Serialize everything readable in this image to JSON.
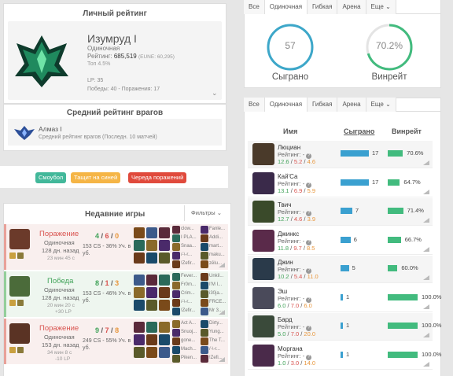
{
  "personal_rating": {
    "title": "Личный рейтинг",
    "tier": "Изумруд I",
    "queue": "Одиночная",
    "rating_label": "Рейтинг:",
    "rating_value": "685,519",
    "rating_region": "(EUNE: 60,295)",
    "top": "Топ 4.5%",
    "lp": "LP: 35",
    "wins_losses": "Победы: 40 - Поражения: 17"
  },
  "enemy_rating": {
    "title": "Средний рейтинг врагов",
    "tier": "Алмаз I",
    "desc": "Средний рейтинг врагов (Последн. 10 матчей)"
  },
  "tags": [
    "Смоубол",
    "Тащит на синей",
    "Череда поражений"
  ],
  "recent_games": {
    "title": "Недавние игры",
    "filter": "Фильтры",
    "games": [
      {
        "result": "Поражение",
        "queue": "Одиночная",
        "ago": "128 дн. назад",
        "duration": "23 мин 45 с",
        "lp": "",
        "k": "4",
        "d": "6",
        "a": "0",
        "stats": "153 CS - 36% Уч. в уб.",
        "players_a": [
          "clow...",
          "I PLA...",
          "Snaa...",
          "/-\\-r...",
          "!Zefir..."
        ],
        "players_b": [
          "Fanle...",
          "Addi...",
          "mart...",
          "maku...",
          "zēlu..."
        ]
      },
      {
        "result": "Победа",
        "queue": "Одиночная",
        "ago": "128 дн. назад",
        "duration": "20 мин 20 с",
        "lp": "+30 LP",
        "k": "8",
        "d": "1",
        "a": "3",
        "stats": "153 CS - 46% Уч. в уб.",
        "players_a": [
          "Fever...",
          "Fr0m...",
          "Crim...",
          "/-\\-r...",
          "!Zefir..."
        ],
        "players_b": [
          "Unkil...",
          "I'M I...",
          "i30ja...",
          "FRCE...",
          "Mr 3..."
        ]
      },
      {
        "result": "Поражение",
        "queue": "Одиночная",
        "ago": "153 дн. назад",
        "duration": "34 мин 8 с",
        "lp": "-10 LP",
        "k": "9",
        "d": "7",
        "a": "8",
        "stats": "249 CS - 55% Уч. в уб.",
        "players_a": [
          "Act A...",
          "Snuoj...",
          "gone...",
          "Mach...",
          "Piken..."
        ],
        "players_b": [
          "Dirty...",
          "Yung...",
          "The T...",
          "/-\\-r...",
          "!Zefi..."
        ]
      }
    ]
  },
  "top_tabs": [
    "Все",
    "Одиночная",
    "Гибкая",
    "Арена",
    "Еще"
  ],
  "summary": {
    "played_value": "57",
    "played_label": "Сыграно",
    "winrate_value": "70.2%",
    "winrate_label": "Винрейт",
    "winrate_fraction": 0.702
  },
  "table": {
    "tabs": [
      "Все",
      "Одиночная",
      "Гибкая",
      "Арена",
      "Еще"
    ],
    "headers": {
      "name": "Имя",
      "played": "Сыграно",
      "winrate": "Винрейт"
    },
    "rating_label": "Рейтинг: -",
    "rows": [
      {
        "name": "Люциан",
        "k": "12.6",
        "d": "5.2",
        "a": "4.6",
        "played": 17,
        "winrate": "70.6%",
        "wr": 70.6
      },
      {
        "name": "Кай'Са",
        "k": "13.1",
        "d": "6.9",
        "a": "5.9",
        "played": 17,
        "winrate": "64.7%",
        "wr": 64.7
      },
      {
        "name": "Твич",
        "k": "12.7",
        "d": "4.6",
        "a": "3.9",
        "played": 7,
        "winrate": "71.4%",
        "wr": 71.4
      },
      {
        "name": "Джинкс",
        "k": "11.8",
        "d": "9.7",
        "a": "8.5",
        "played": 6,
        "winrate": "66.7%",
        "wr": 66.7
      },
      {
        "name": "Джин",
        "k": "10.2",
        "d": "5.4",
        "a": "11.0",
        "played": 5,
        "winrate": "60.0%",
        "wr": 60.0
      },
      {
        "name": "Эш",
        "k": "6.0",
        "d": "7.0",
        "a": "6.0",
        "played": 1,
        "winrate": "100.0%",
        "wr": 100
      },
      {
        "name": "Бард",
        "k": "5.0",
        "d": "7.0",
        "a": "20.0",
        "played": 1,
        "winrate": "100.0%",
        "wr": 100
      },
      {
        "name": "Моргана",
        "k": "1.0",
        "d": "3.0",
        "a": "14.0",
        "played": 1,
        "winrate": "100.0%",
        "wr": 100
      }
    ]
  }
}
